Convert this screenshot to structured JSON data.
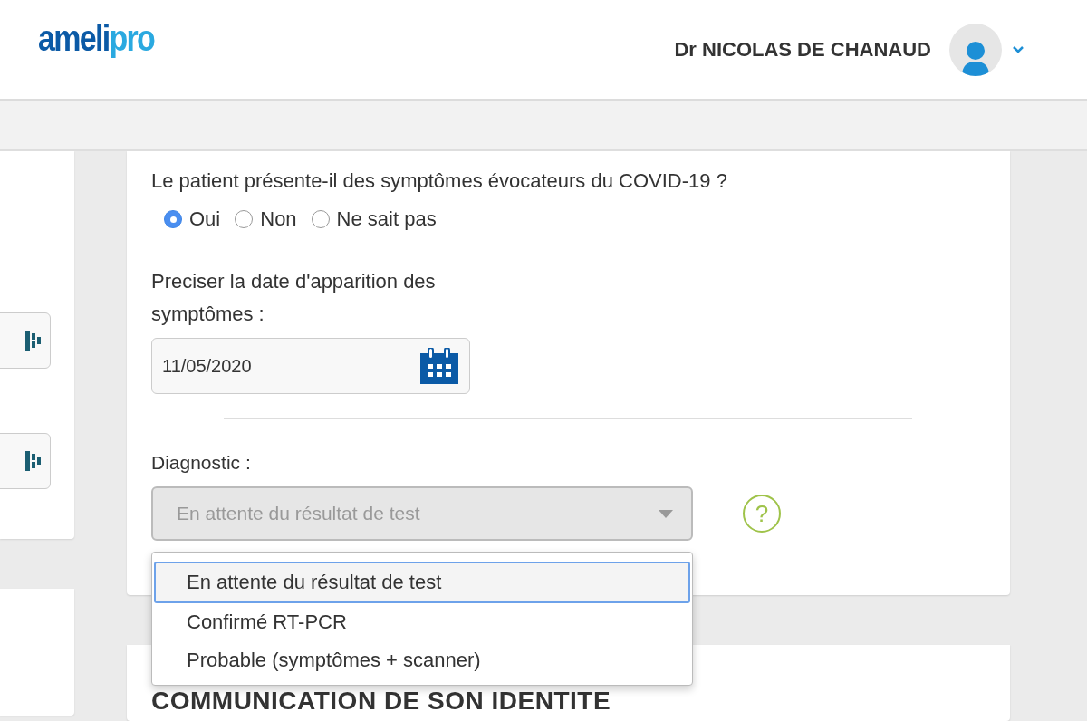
{
  "header": {
    "logo_primary": "ameli",
    "logo_secondary": "pro",
    "user_name": "Dr NICOLAS DE CHANAUD"
  },
  "form": {
    "question": "Le patient présente-il des symptômes évocateurs du COVID-19 ?",
    "radios": [
      {
        "label": "Oui",
        "selected": true
      },
      {
        "label": "Non",
        "selected": false
      },
      {
        "label": "Ne sait pas",
        "selected": false
      }
    ],
    "date_label": "Preciser la date d'apparition des symptômes :",
    "date_value": "11/05/2020",
    "diagnostic_label": "Diagnostic :",
    "diagnostic_select": {
      "value": "En attente du résultat de test",
      "expanded": true
    },
    "diagnostic_options": [
      {
        "label": "En attente du résultat de test",
        "selected": true
      },
      {
        "label": "Confirmé RT-PCR",
        "selected": false
      },
      {
        "label": "Probable (symptômes + scanner)",
        "selected": false
      }
    ],
    "help": "?"
  },
  "next_section": {
    "title": "COMMUNICATION DE SON IDENTITE"
  }
}
